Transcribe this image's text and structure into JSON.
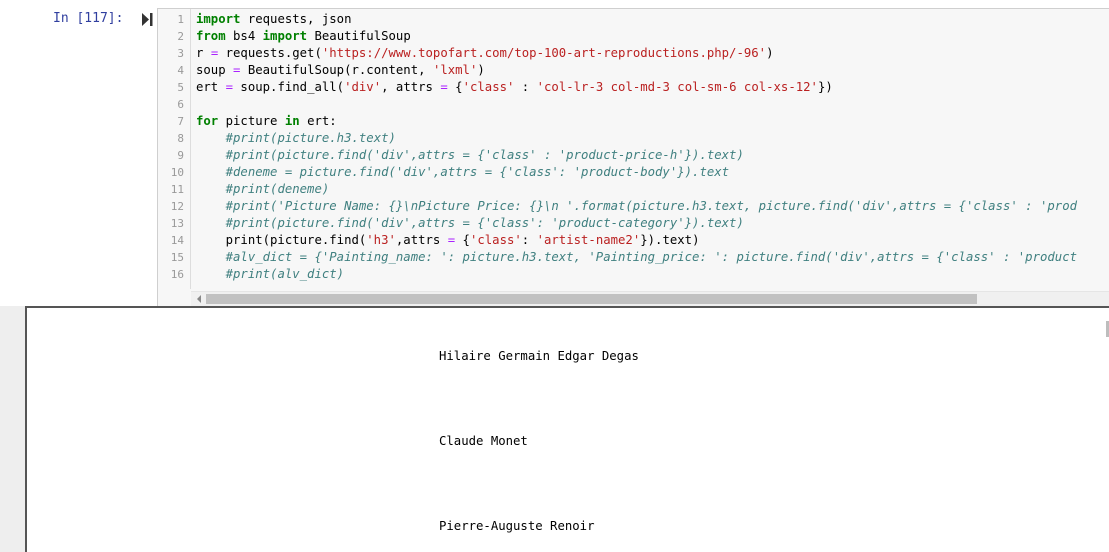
{
  "cell": {
    "prompt": "In [117]:",
    "run_icon": "run-cell-icon"
  },
  "code": {
    "line_numbers": [
      "1",
      "2",
      "3",
      "4",
      "5",
      "6",
      "7",
      "8",
      "9",
      "10",
      "11",
      "12",
      "13",
      "14",
      "15",
      "16"
    ],
    "lines": [
      [
        {
          "t": "import",
          "c": "kw"
        },
        {
          "t": " requests, json"
        }
      ],
      [
        {
          "t": "from",
          "c": "kw"
        },
        {
          "t": " bs4 "
        },
        {
          "t": "import",
          "c": "kw"
        },
        {
          "t": " BeautifulSoup"
        }
      ],
      [
        {
          "t": "r "
        },
        {
          "t": "=",
          "c": "op"
        },
        {
          "t": " requests.get("
        },
        {
          "t": "'https://www.topofart.com/top-100-art-reproductions.php/-96'",
          "c": "str"
        },
        {
          "t": ")"
        }
      ],
      [
        {
          "t": "soup "
        },
        {
          "t": "=",
          "c": "op"
        },
        {
          "t": " BeautifulSoup(r.content, "
        },
        {
          "t": "'lxml'",
          "c": "str"
        },
        {
          "t": ")"
        }
      ],
      [
        {
          "t": "ert "
        },
        {
          "t": "=",
          "c": "op"
        },
        {
          "t": " soup.find_all("
        },
        {
          "t": "'div'",
          "c": "str"
        },
        {
          "t": ", attrs "
        },
        {
          "t": "=",
          "c": "op"
        },
        {
          "t": " {"
        },
        {
          "t": "'class'",
          "c": "str"
        },
        {
          "t": " : "
        },
        {
          "t": "'col-lr-3 col-md-3 col-sm-6 col-xs-12'",
          "c": "str"
        },
        {
          "t": "})"
        }
      ],
      [
        {
          "t": ""
        }
      ],
      [
        {
          "t": "for",
          "c": "kw"
        },
        {
          "t": " picture "
        },
        {
          "t": "in",
          "c": "kw"
        },
        {
          "t": " ert:"
        }
      ],
      [
        {
          "t": "    "
        },
        {
          "t": "#print(picture.h3.text)",
          "c": "cm"
        }
      ],
      [
        {
          "t": "    "
        },
        {
          "t": "#print(picture.find('div',attrs = {'class' : 'product-price-h'}).text)",
          "c": "cm"
        }
      ],
      [
        {
          "t": "    "
        },
        {
          "t": "#deneme = picture.find('div',attrs = {'class': 'product-body'}).text",
          "c": "cm"
        }
      ],
      [
        {
          "t": "    "
        },
        {
          "t": "#print(deneme)",
          "c": "cm"
        }
      ],
      [
        {
          "t": "    "
        },
        {
          "t": "#print('Picture Name: {}\\nPicture Price: {}\\n '.format(picture.h3.text, picture.find('div',attrs = {'class' : 'prod",
          "c": "cm"
        }
      ],
      [
        {
          "t": "    "
        },
        {
          "t": "#print(picture.find('div',attrs = {'class': 'product-category'}).text)",
          "c": "cm"
        }
      ],
      [
        {
          "t": "    print(picture.find("
        },
        {
          "t": "'h3'",
          "c": "str"
        },
        {
          "t": ",attrs "
        },
        {
          "t": "=",
          "c": "op"
        },
        {
          "t": " {"
        },
        {
          "t": "'class'",
          "c": "str"
        },
        {
          "t": ": "
        },
        {
          "t": "'artist-name2'",
          "c": "str"
        },
        {
          "t": "}).text)"
        }
      ],
      [
        {
          "t": "    "
        },
        {
          "t": "#alv_dict = {'Painting_name: ': picture.h3.text, 'Painting_price: ': picture.find('div',attrs = {'class' : 'product",
          "c": "cm"
        }
      ],
      [
        {
          "t": "    "
        },
        {
          "t": "#print(alv_dict)",
          "c": "cm"
        }
      ]
    ]
  },
  "output": {
    "lines": [
      "Hilaire Germain Edgar Degas",
      "Claude Monet",
      "Pierre-Auguste Renoir"
    ]
  }
}
